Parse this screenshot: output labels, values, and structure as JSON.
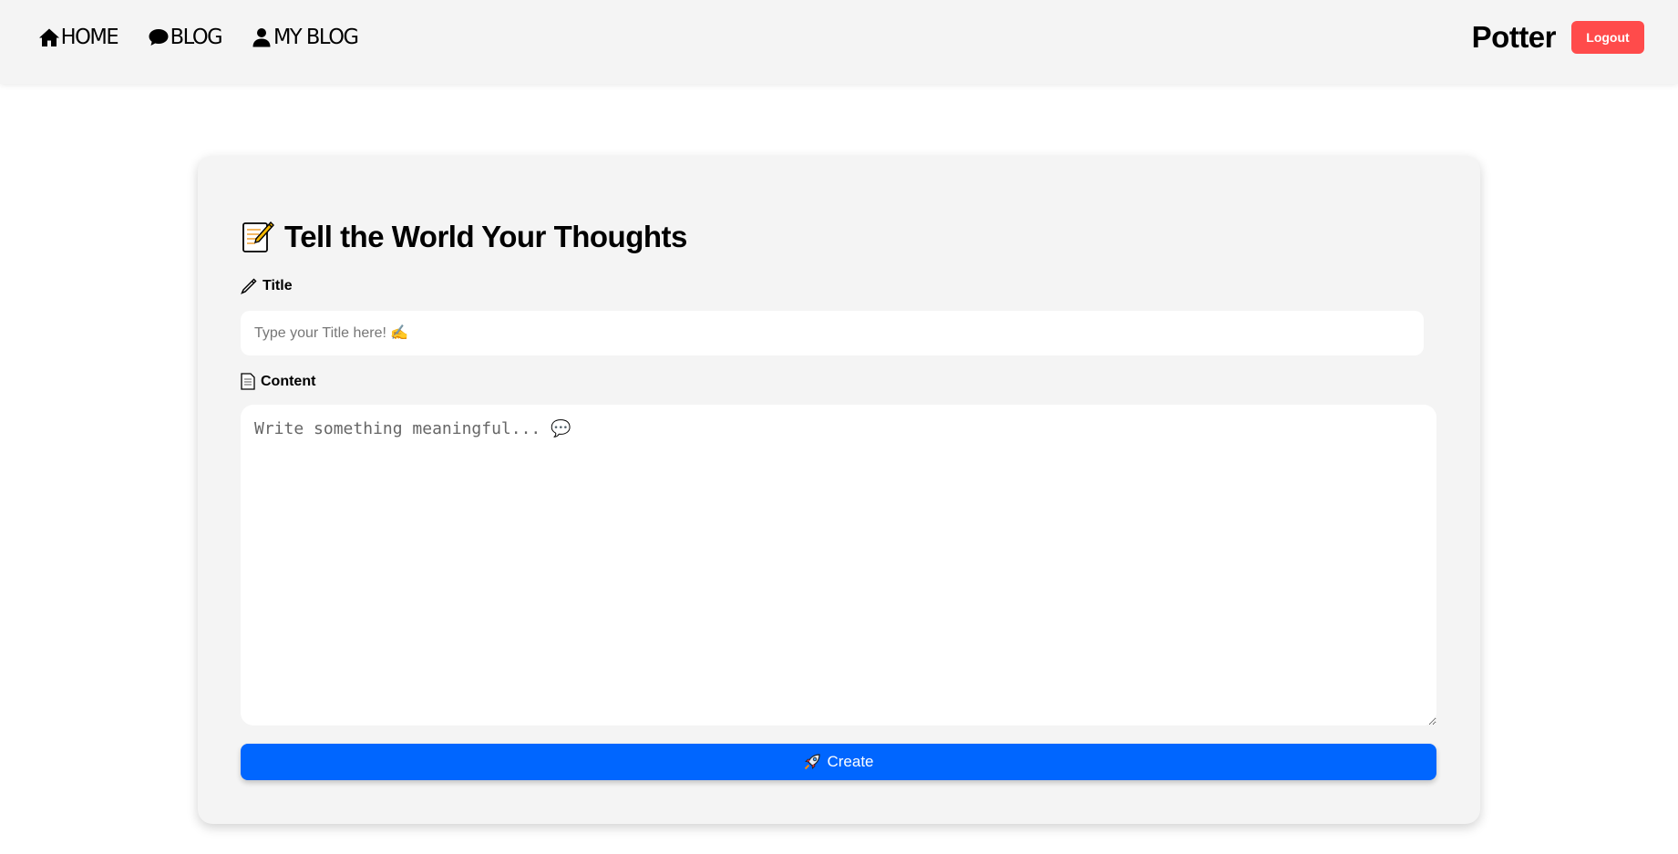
{
  "header": {
    "nav": [
      {
        "label": "HOME",
        "icon": "home-icon"
      },
      {
        "label": "BLOG",
        "icon": "chat-bubble-icon"
      },
      {
        "label": "MY BLOG",
        "icon": "user-icon"
      }
    ],
    "username": "Potter",
    "logout_label": "Logout"
  },
  "form": {
    "heading": "Tell the World Your Thoughts",
    "heading_icon": "memo-icon",
    "title_label": "Title",
    "title_icon": "pencil-icon",
    "title_placeholder": "Type your Title here! ✍️",
    "content_label": "Content",
    "content_icon": "page-icon",
    "content_placeholder": "Write something meaningful... 💬",
    "create_label": "Create",
    "create_icon": "rocket-icon"
  },
  "colors": {
    "header_bg": "#f4f4f4",
    "logout_bg": "#ff4b4b",
    "create_bg": "#0066ff",
    "card_bg": "#f4f4f4"
  }
}
